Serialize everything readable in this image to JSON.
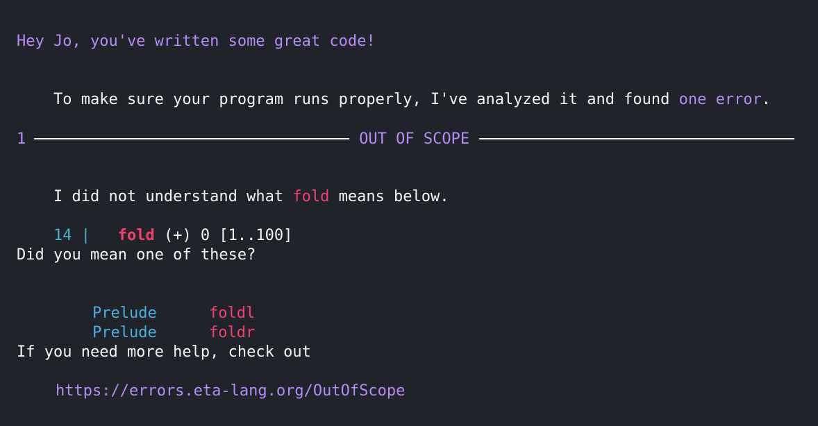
{
  "greeting": "Hey Jo, you've written some great code!",
  "summary": {
    "prefix": "To make sure your program runs properly, I've analyzed it and found ",
    "highlight": "one error",
    "suffix": "."
  },
  "error": {
    "number": "1",
    "title": "OUT OF SCOPE",
    "message": {
      "prefix": "I did not understand what ",
      "term": "fold",
      "suffix": " means below."
    },
    "code": {
      "line_number": "14 |",
      "term": "fold",
      "rest": " (+) 0 [1..100]"
    },
    "suggest_prompt": "Did you mean one of these?",
    "suggestions": [
      {
        "module": "Prelude",
        "name": "foldl"
      },
      {
        "module": "Prelude",
        "name": "foldr"
      }
    ],
    "help_text": "If you need more help, check out",
    "help_url": "https://errors.eta-lang.org/OutOfScope"
  },
  "colors": {
    "background": "#21232a",
    "text": "#f4f4f4",
    "accent_purple": "#b48cf2",
    "error_red": "#f0406e",
    "line_cyan": "#3fb6c9",
    "module_blue": "#4aaedc"
  }
}
